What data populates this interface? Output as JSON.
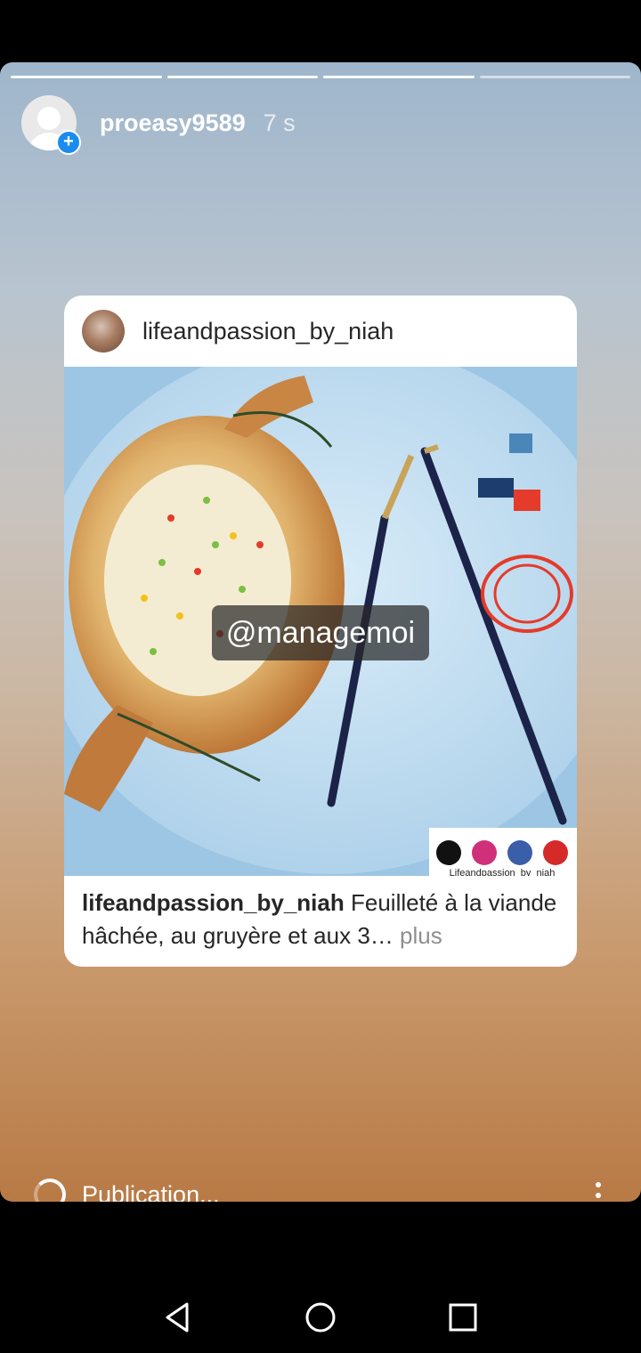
{
  "story": {
    "username": "proeasy9589",
    "time": "7 s",
    "progress_segments": [
      1,
      1,
      1,
      0
    ]
  },
  "post": {
    "username": "lifeandpassion_by_niah",
    "caption_user": "lifeandpassion_by_niah",
    "caption_text": "Feuilleté à la viande hâchée, au gruyère et aux 3…",
    "caption_more": "plus",
    "watermark_text": "Lifeandpassion_by_niah"
  },
  "mention_sticker": "@managemoi",
  "footer": {
    "status": "Publication..."
  },
  "icons": {
    "add": "plus-icon",
    "more": "more-vertical-icon",
    "nav_back": "back-triangle-icon",
    "nav_home": "home-circle-icon",
    "nav_recent": "recent-square-icon"
  },
  "colors": {
    "accent": "#1a8cf0",
    "background": "#000000"
  }
}
